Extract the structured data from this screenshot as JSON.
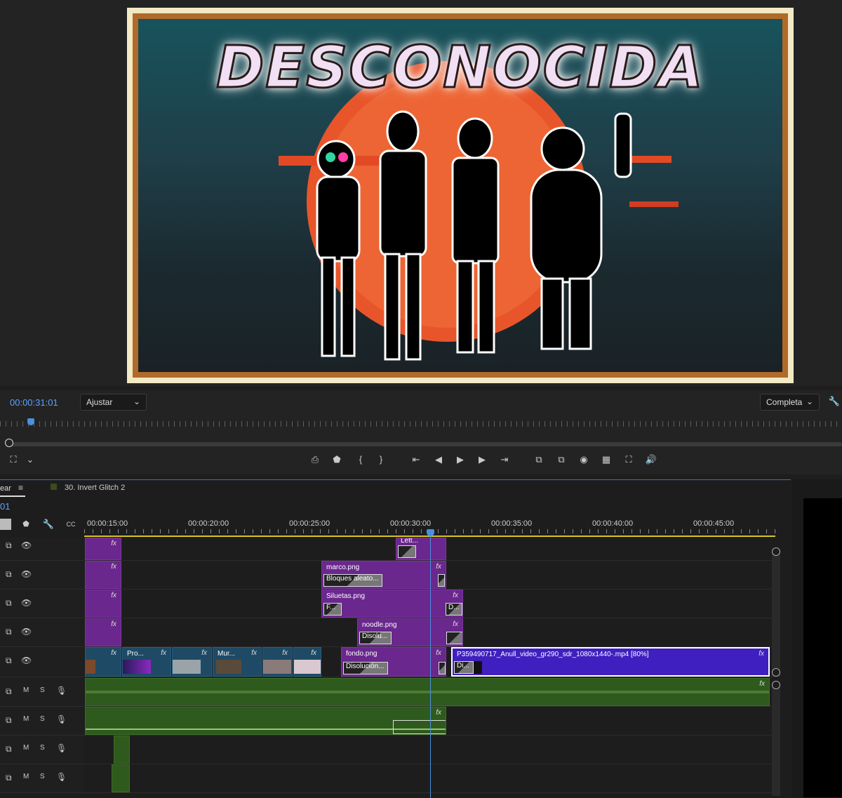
{
  "monitor": {
    "title_text": "DESCONOCIDA",
    "timecode": "00:00:31:01",
    "fit_dropdown": "Ajustar",
    "resolution_dropdown": "Completa",
    "playhead_progress": 0.03
  },
  "transport": {
    "icons": [
      "export-frame-icon",
      "marker-icon",
      "mark-in-icon",
      "mark-out-icon",
      "go-to-in-icon",
      "step-back-icon",
      "play-icon",
      "step-forward-icon",
      "go-to-out-icon",
      "lift-icon",
      "extract-icon",
      "camera-icon",
      "comparison-view-icon",
      "vr-icon",
      "audio-icon"
    ]
  },
  "timeline": {
    "tab_partial": "ear",
    "sequence_tab": "30. Invert Glitch 2",
    "timecode_partial": "01",
    "ruler_labels": [
      "00:00:15:00",
      "00:00:20:00",
      "00:00:25:00",
      "00:00:30:00",
      "00:00:35:00",
      "00:00:40:00",
      "00:00:45:00"
    ],
    "clips": {
      "v4_partial": "Lett...",
      "marco": "marco.png",
      "marco_tr": "Bloques aleato...",
      "siluetas": "Siluetas.png",
      "siluetas_tr1": "F...",
      "siluetas_tr2": "D...",
      "noodle": "noodle.png",
      "noodle_tr": "Disolu...",
      "pro": "Pro...",
      "mur": "Mur...",
      "fondo": "fondo.png",
      "fondo_tr": "Disolución...",
      "video": "P359490717_Anull_video_gr290_sdr_1080x1440-.mp4 [80%]",
      "video_tr": "Di...",
      "fx": "fx"
    },
    "audio_labels": {
      "mute": "M",
      "solo": "S"
    }
  }
}
